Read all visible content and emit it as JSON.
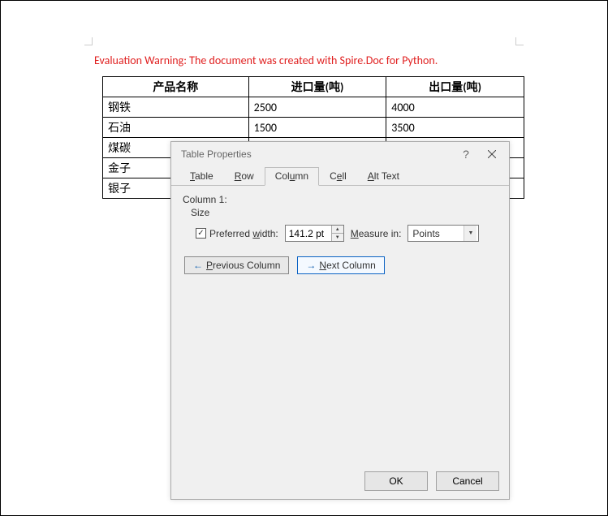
{
  "warning": "Evaluation Warning: The document was created with Spire.Doc for Python.",
  "table": {
    "headers": [
      "产品名称",
      "进口量(吨)",
      "出口量(吨)"
    ],
    "rows": [
      [
        "钢铁",
        "2500",
        "4000"
      ],
      [
        "石油",
        "1500",
        "3500"
      ],
      [
        "煤碳",
        "",
        ""
      ],
      [
        "金子",
        "",
        ""
      ],
      [
        "银子",
        "",
        ""
      ]
    ]
  },
  "dialog": {
    "title": "Table Properties",
    "tabs": {
      "table": "Table",
      "row": "Row",
      "column": "Column",
      "cell": "Cell",
      "alt": "Alt Text"
    },
    "column_panel": {
      "heading": "Column 1:",
      "size_label": "Size",
      "pref_width_label": "Preferred width:",
      "pref_width_value": "141.2 pt",
      "measure_label": "Measure in:",
      "measure_value": "Points",
      "prev_btn": "Previous Column",
      "next_btn": "Next Column"
    },
    "footer": {
      "ok": "OK",
      "cancel": "Cancel"
    }
  },
  "chart_data": {
    "type": "table",
    "title": "",
    "columns": [
      "产品名称",
      "进口量(吨)",
      "出口量(吨)"
    ],
    "rows": [
      {
        "产品名称": "钢铁",
        "进口量(吨)": 2500,
        "出口量(吨)": 4000
      },
      {
        "产品名称": "石油",
        "进口量(吨)": 1500,
        "出口量(吨)": 3500
      },
      {
        "产品名称": "煤碳",
        "进口量(吨)": null,
        "出口量(吨)": null
      },
      {
        "产品名称": "金子",
        "进口量(吨)": null,
        "出口量(吨)": null
      },
      {
        "产品名称": "银子",
        "进口量(吨)": null,
        "出口量(吨)": null
      }
    ]
  }
}
